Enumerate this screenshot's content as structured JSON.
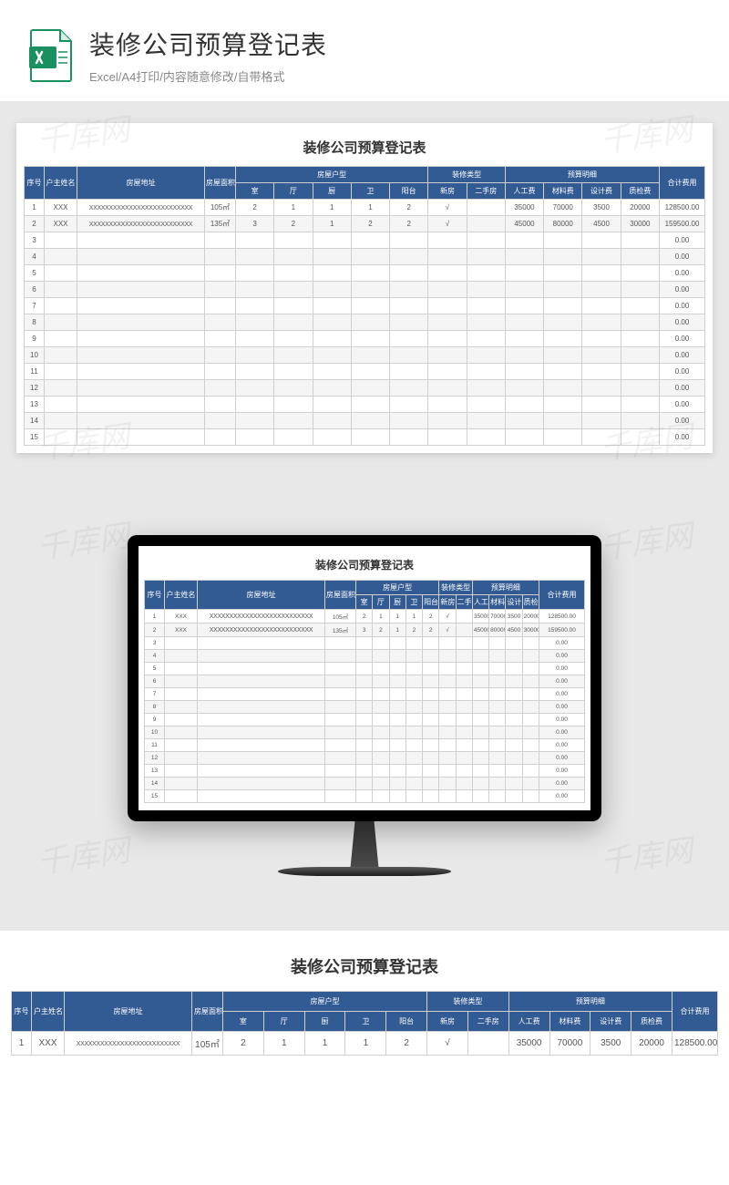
{
  "header": {
    "title": "装修公司预算登记表",
    "subtitle": "Excel/A4打印/内容随意修改/自带格式"
  },
  "sheet": {
    "title": "装修公司预算登记表"
  },
  "columns": {
    "row1": [
      "序号",
      "户主姓名",
      "房屋地址",
      "房屋面积",
      "房屋户型",
      "装修类型",
      "预算明细",
      "合计费用"
    ],
    "row2": [
      "室",
      "厅",
      "厨",
      "卫",
      "阳台",
      "新房",
      "二手房",
      "人工费",
      "材料费",
      "设计费",
      "质检费"
    ]
  },
  "rows": [
    {
      "seq": "1",
      "name": "XXX",
      "addr": "XXXXXXXXXXXXXXXXXXXXXXXXXX",
      "area": "105㎡",
      "shi": "2",
      "ting": "1",
      "chu": "1",
      "wei": "1",
      "yang": "2",
      "xin": "√",
      "er": "",
      "labor": "35000",
      "material": "70000",
      "design": "3500",
      "qc": "20000",
      "total": "128500.00"
    },
    {
      "seq": "2",
      "name": "XXX",
      "addr": "XXXXXXXXXXXXXXXXXXXXXXXXXX",
      "area": "135㎡",
      "shi": "3",
      "ting": "2",
      "chu": "1",
      "wei": "2",
      "yang": "2",
      "xin": "√",
      "er": "",
      "labor": "45000",
      "material": "80000",
      "design": "4500",
      "qc": "30000",
      "total": "159500.00"
    },
    {
      "seq": "3",
      "total": "0.00"
    },
    {
      "seq": "4",
      "total": "0.00"
    },
    {
      "seq": "5",
      "total": "0.00"
    },
    {
      "seq": "6",
      "total": "0.00"
    },
    {
      "seq": "7",
      "total": "0.00"
    },
    {
      "seq": "8",
      "total": "0.00"
    },
    {
      "seq": "9",
      "total": "0.00"
    },
    {
      "seq": "10",
      "total": "0.00"
    },
    {
      "seq": "11",
      "total": "0.00"
    },
    {
      "seq": "12",
      "total": "0.00"
    },
    {
      "seq": "13",
      "total": "0.00"
    },
    {
      "seq": "14",
      "total": "0.00"
    },
    {
      "seq": "15",
      "total": "0.00"
    }
  ],
  "watermark": "千库网"
}
